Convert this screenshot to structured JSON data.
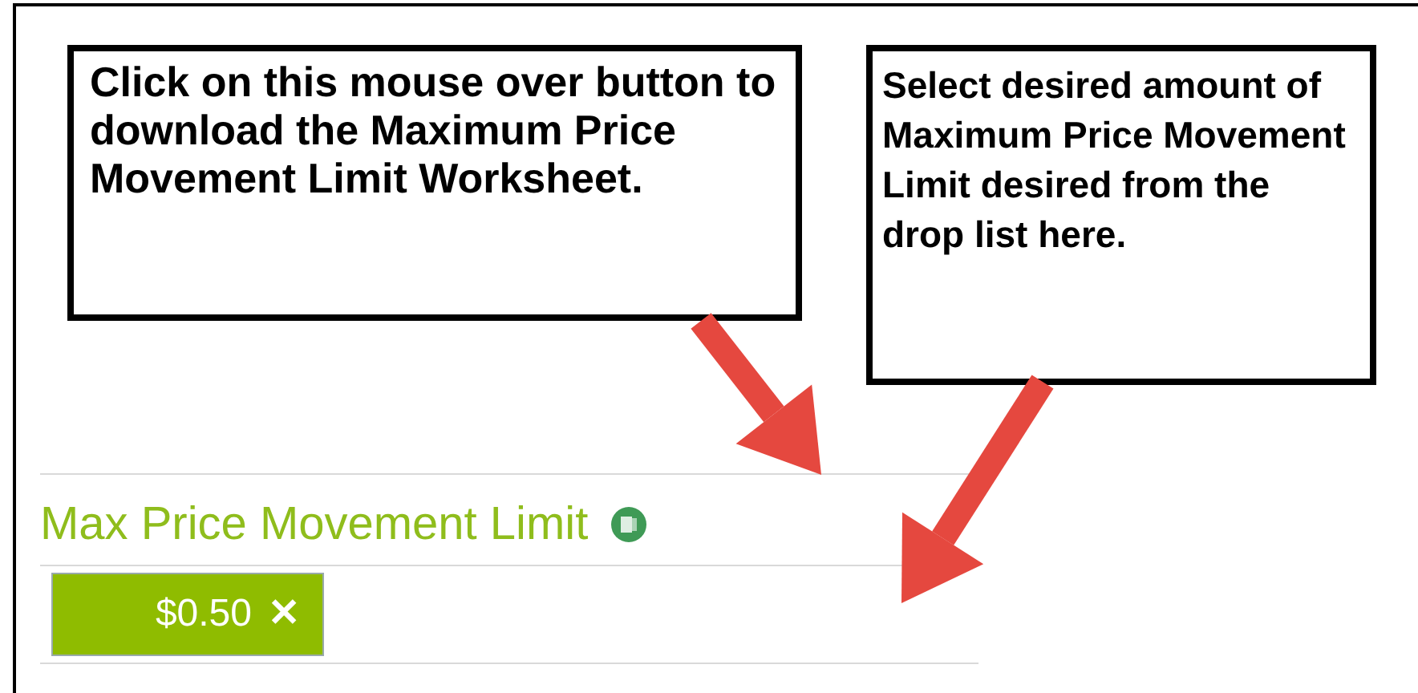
{
  "callouts": [
    "Click on this mouse over button to download the Maximum Price Movement Limit Worksheet.",
    "Select desired amount of Maximum Price Movement Limit desired from the drop list here."
  ],
  "section": {
    "title": "Max Price Movement Limit"
  },
  "selected_values": [
    {
      "label": "$0.50",
      "remove": "✕"
    }
  ]
}
